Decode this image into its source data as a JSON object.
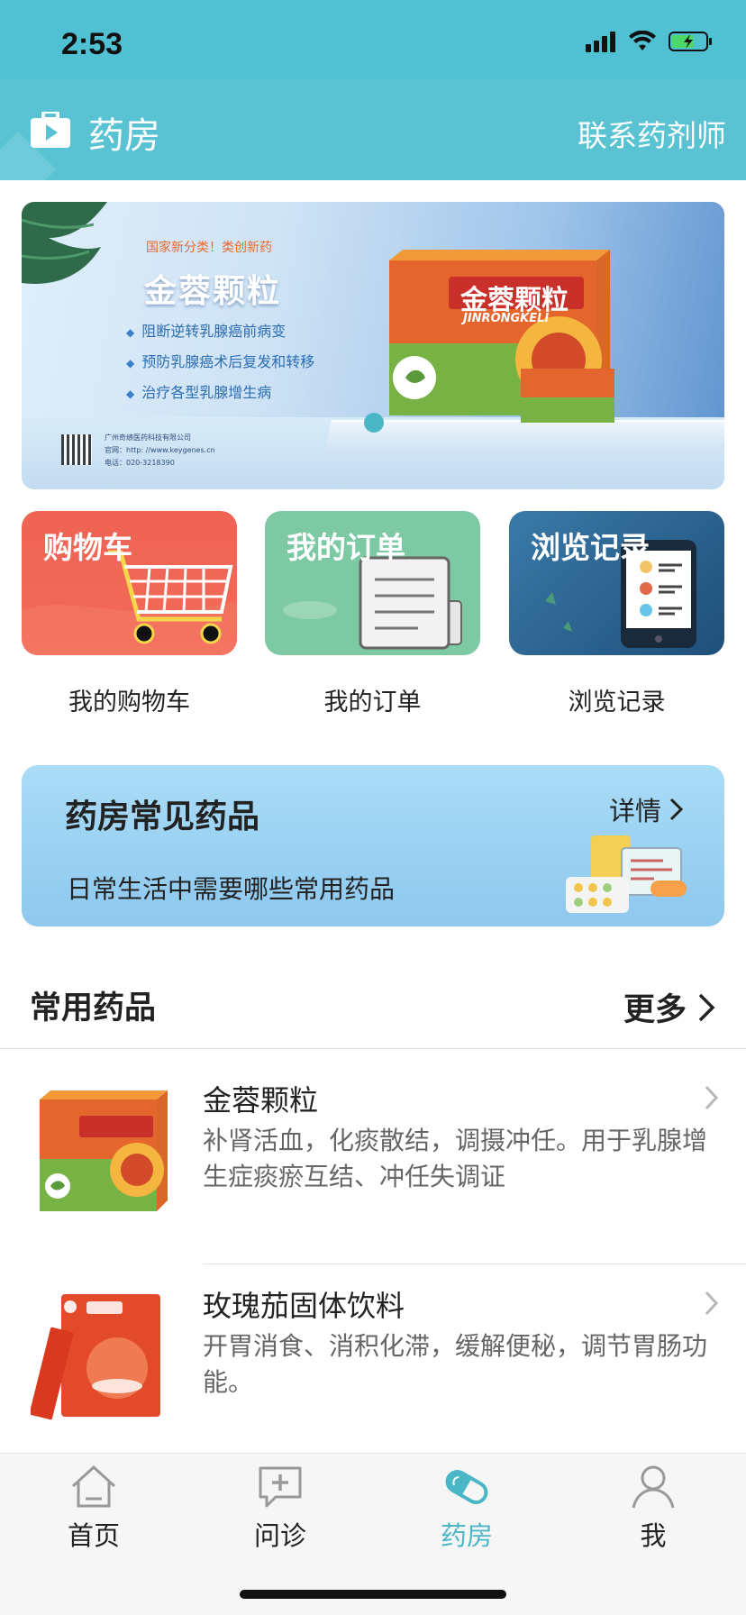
{
  "status": {
    "time": "2:53"
  },
  "header": {
    "title": "药房",
    "action": "联系药剂师",
    "icon": "medical-bag-icon"
  },
  "banner": {
    "tag": "国家新分类！类创新药",
    "title": "金蓉颗粒",
    "points": [
      "阻断逆转乳腺癌前病变",
      "预防乳腺癌术后复发和转移",
      "治疗各型乳腺增生病"
    ],
    "company": [
      "广州奇绩医药科技有限公司",
      "官网：http: //www.keygenes.cn",
      "电话：020-3218390"
    ],
    "box_title": "金蓉颗粒",
    "box_subtitle": "JINRONGKELI"
  },
  "entries": [
    {
      "card_title": "购物车",
      "caption": "我的购物车",
      "icon": "shopping-cart-icon",
      "color": "#f0604f"
    },
    {
      "card_title": "我的订单",
      "caption": "我的订单",
      "icon": "order-document-icon",
      "color": "#7dc9a3"
    },
    {
      "card_title": "浏览记录",
      "caption": "浏览记录",
      "icon": "browse-history-icon",
      "color": "#2f6791"
    }
  ],
  "feature": {
    "title": "药房常见药品",
    "subtitle": "日常生活中需要哪些常用药品",
    "more": "详情"
  },
  "section": {
    "title": "常用药品",
    "more": "更多"
  },
  "products": [
    {
      "name": "金蓉颗粒",
      "desc": "补肾活血，化痰散结，调摄冲任。用于乳腺增生症痰瘀互结、冲任失调证"
    },
    {
      "name": "玫瑰茄固体饮料",
      "desc": "开胃消食、消积化滞，缓解便秘，调节胃肠功能。"
    }
  ],
  "tabs": [
    {
      "label": "首页",
      "icon": "home-icon",
      "active": false
    },
    {
      "label": "问诊",
      "icon": "consult-chat-icon",
      "active": false
    },
    {
      "label": "药房",
      "icon": "pill-capsule-icon",
      "active": true
    },
    {
      "label": "我",
      "icon": "user-profile-icon",
      "active": false
    }
  ],
  "colors": {
    "accent": "#4bb6c6",
    "header": "#59c3d4"
  }
}
